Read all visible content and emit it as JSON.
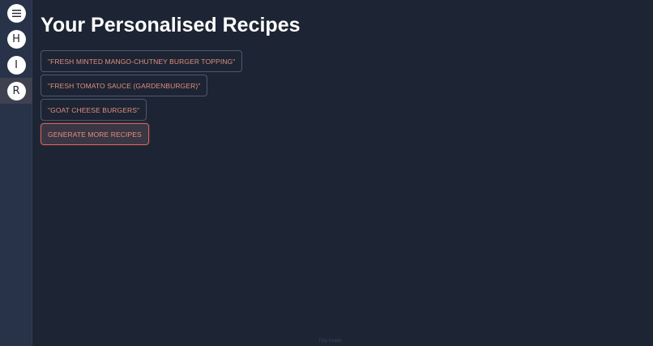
{
  "sidebar": {
    "items": [
      {
        "icon": "hamburger-menu-icon",
        "label": ""
      },
      {
        "label": "H"
      },
      {
        "label": "I"
      },
      {
        "label": "R"
      }
    ]
  },
  "main": {
    "title": "Your Personalised Recipes",
    "recipes": [
      "\"FRESH MINTED MANGO-CHUTNEY BURGER TOPPING\"",
      "\"FRESH TOMATO SAUCE (GARDENBURGER)\"",
      "\"GOAT CHEESE BURGERS\""
    ],
    "generate_label": "GENERATE MORE RECIPES"
  },
  "footer": {
    "text": "Tiny Inside"
  },
  "colors": {
    "background": "#1d2433",
    "sidebar": "#283349",
    "accent": "#e09080",
    "accent_border": "#d0685a"
  }
}
